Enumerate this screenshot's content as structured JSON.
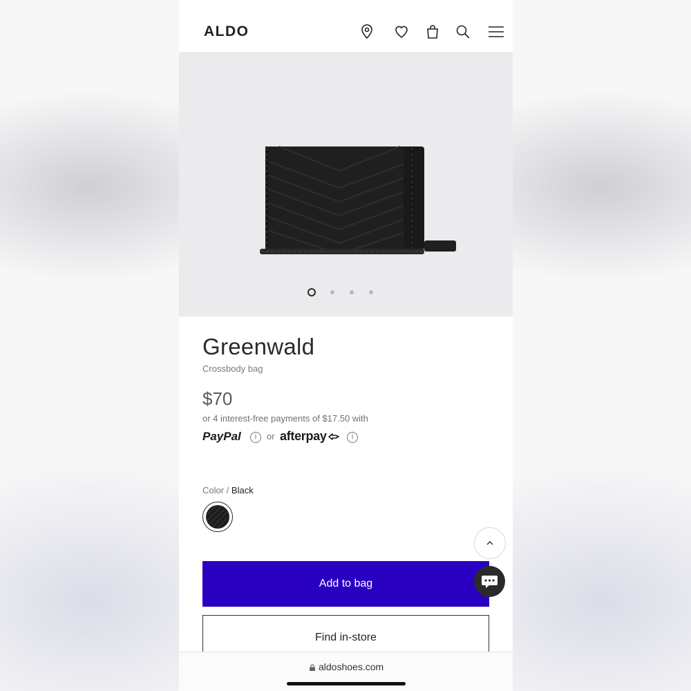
{
  "header": {
    "logo": "ALDO",
    "icons": [
      "location-pin-icon",
      "heart-icon",
      "shopping-bag-icon",
      "search-icon",
      "hamburger-menu-icon"
    ]
  },
  "gallery": {
    "image_count": 4,
    "active_index": 0
  },
  "product": {
    "name": "Greenwald",
    "type": "Crossbody bag",
    "price": "$70",
    "installments": "or 4 interest-free payments of $17.50 with",
    "paypal": "PayPal",
    "or": "or",
    "afterpay": "afterpay",
    "color_label": "Color /",
    "color_value": "Black",
    "swatch_color": "#1c1c1c"
  },
  "actions": {
    "add_to_bag": "Add to bag",
    "find_in_store": "Find in-store"
  },
  "browser": {
    "url": "aldoshoes.com"
  },
  "colors": {
    "accent": "#2a00c2",
    "gallery_bg": "#ebebed"
  }
}
